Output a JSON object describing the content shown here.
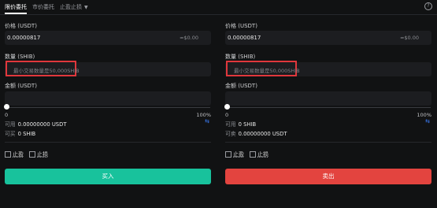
{
  "tabs": {
    "limit": "限价委托",
    "market": "市价委托",
    "stop": "止盈止损"
  },
  "colors": {
    "buy": "#18c29c",
    "sell": "#e3443f",
    "highlight": "#e0373c",
    "swap": "#3b7cf7"
  },
  "buy": {
    "price_label": "价格 (USDT)",
    "price_value": "0.00000817",
    "price_fiat": "≈$0.00",
    "qty_label": "数量 (SHIB)",
    "qty_placeholder": "最小交易数量是50,000SHIB",
    "amount_label": "金额 (USDT)",
    "slider_min": "0",
    "slider_max": "100%",
    "slider_level": 0,
    "avail_label": "可用",
    "avail_value": "0.00000000 USDT",
    "can_label": "可买",
    "can_value": "0 SHIB",
    "tp_label": "止盈",
    "sl_label": "止损",
    "button": "买入"
  },
  "sell": {
    "price_label": "价格 (USDT)",
    "price_value": "0.00000817",
    "price_fiat": "≈$0.00",
    "qty_label": "数量 (SHIB)",
    "qty_placeholder": "最小交易数量是50,000SHIB",
    "amount_label": "金额 (USDT)",
    "slider_min": "0",
    "slider_max": "100%",
    "slider_level": 0,
    "avail_label": "可用",
    "avail_value": "0 SHIB",
    "can_label": "可卖",
    "can_value": "0.00000000 USDT",
    "tp_label": "止盈",
    "sl_label": "止损",
    "button": "卖出"
  },
  "icons": {
    "help": "help-circle-icon",
    "swap": "swap-arrows-icon",
    "chevron": "chevron-down-icon"
  }
}
